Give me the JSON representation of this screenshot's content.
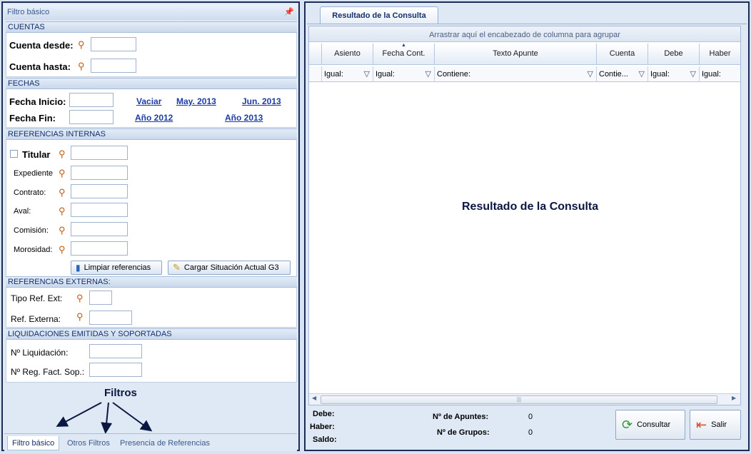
{
  "left_panel": {
    "title": "Filtro básico",
    "cuentas": {
      "header": "CUENTAS",
      "desde_label": "Cuenta desde:",
      "hasta_label": "Cuenta hasta:",
      "desde_value": "",
      "hasta_value": ""
    },
    "fechas": {
      "header": "FECHAS",
      "inicio_label": "Fecha Inicio:",
      "fin_label": "Fecha Fin:",
      "links": [
        "Vaciar",
        "May. 2013",
        "Jun. 2013",
        "Año 2012",
        "Año 2013"
      ]
    },
    "refs_internas": {
      "header": "REFERENCIAS INTERNAS",
      "titular_label": "Titular",
      "expediente_label": "Expediente",
      "contrato_label": "Contrato:",
      "aval_label": "Aval:",
      "comision_label": "Comisión:",
      "morosidad_label": "Morosidad:",
      "limpiar_label": "Limpiar referencias",
      "cargar_label": "Cargar Situación Actual G3"
    },
    "refs_externas": {
      "header": "REFERENCIAS EXTERNAS:",
      "tipo_label": "Tipo Ref. Ext:",
      "externa_label": "Ref. Externa:"
    },
    "liquidaciones": {
      "header": "LIQUIDACIONES EMITIDAS Y SOPORTADAS",
      "liq_label": "Nº Liquidación:",
      "reg_label": "Nº Reg. Fact. Sop.:"
    },
    "annotation": "Filtros",
    "tabs": [
      "Filtro básico",
      "Otros Filtros",
      "Presencia de Referencias"
    ],
    "active_tab": "Filtro básico"
  },
  "right_panel": {
    "tab_label": "Resultado de la Consulta",
    "group_hint": "Arrastrar aquí el encabezado de columna para agrupar",
    "columns": [
      {
        "name": "Asiento",
        "filter": "Igual:"
      },
      {
        "name": "Fecha Cont.",
        "filter": "Igual:"
      },
      {
        "name": "Texto Apunte",
        "filter": "Contiene:"
      },
      {
        "name": "Cuenta",
        "filter": "Contie..."
      },
      {
        "name": "Debe",
        "filter": "Igual:"
      },
      {
        "name": "Haber",
        "filter": "Igual:"
      }
    ],
    "result_label": "Resultado de la Consulta",
    "summary": {
      "debe_label": "Debe:",
      "haber_label": "Haber:",
      "saldo_label": "Saldo:",
      "apuntes_label": "Nº de Apuntes:",
      "apuntes_value": "0",
      "grupos_label": "Nº de Grupos:",
      "grupos_value": "0"
    },
    "consultar_label": "Consultar",
    "salir_label": "Salir"
  },
  "colors": {
    "border_dark": "#1d2b55",
    "link": "#1d3ca3",
    "section_text": "#15306a"
  }
}
